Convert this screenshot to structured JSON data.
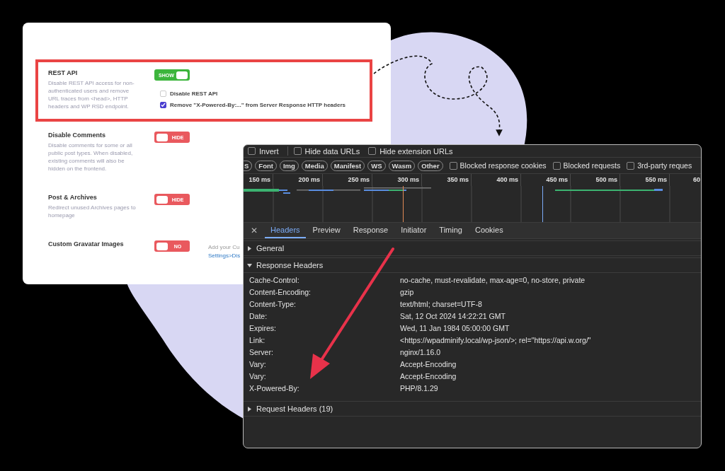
{
  "settings": {
    "rows": [
      {
        "title": "REST API",
        "description": "Disable REST API access for non-authenticated users and remove URL traces from <head>, HTTP headers and WP RSD endpoint.",
        "highlighted": true,
        "toggle": {
          "label": "SHOW",
          "on": true
        },
        "options": [
          {
            "label": "Disable REST API",
            "checked": false
          },
          {
            "label": "Remove \"X-Powered-By:...\" from Server Response HTTP headers",
            "checked": true
          }
        ]
      },
      {
        "title": "Disable Comments",
        "description": "Disable comments for some or all public post types. When disabled, existing comments will also be hidden on the frontend.",
        "highlighted": false,
        "toggle": {
          "label": "HIDE",
          "on": false
        }
      },
      {
        "title": "Post & Archives",
        "description": "Redirect unused Archives pages to homepage",
        "highlighted": false,
        "toggle": {
          "label": "HIDE",
          "on": false
        }
      },
      {
        "title": "Custom Gravatar Images",
        "highlighted": false,
        "toggle": {
          "label": "NO",
          "on": false
        },
        "note": {
          "text": "Add your Cu",
          "link": "Settings>Dis"
        }
      }
    ]
  },
  "devtools": {
    "options": [
      {
        "label": "Invert",
        "checked": false
      },
      {
        "label": "Hide data URLs",
        "checked": false
      },
      {
        "label": "Hide extension URLs",
        "checked": false
      }
    ],
    "filters": [
      {
        "label": "S",
        "selected": false
      },
      {
        "label": "Font",
        "selected": false
      },
      {
        "label": "Img",
        "selected": false
      },
      {
        "label": "Media",
        "selected": false
      },
      {
        "label": "Manifest",
        "selected": false
      },
      {
        "label": "WS",
        "selected": false
      },
      {
        "label": "Wasm",
        "selected": false
      },
      {
        "label": "Other",
        "selected": false
      }
    ],
    "filter_options": [
      {
        "label": "Blocked response cookies",
        "checked": false
      },
      {
        "label": "Blocked requests",
        "checked": false
      },
      {
        "label": "3rd-party reques",
        "checked": false
      }
    ],
    "timeline_ticks": [
      "150 ms",
      "200 ms",
      "250 ms",
      "300 ms",
      "350 ms",
      "400 ms",
      "450 ms",
      "500 ms",
      "550 ms",
      "60"
    ],
    "close": "✕",
    "tabs": [
      {
        "label": "Headers",
        "selected": true
      },
      {
        "label": "Preview",
        "selected": false
      },
      {
        "label": "Response",
        "selected": false
      },
      {
        "label": "Initiator",
        "selected": false
      },
      {
        "label": "Timing",
        "selected": false
      },
      {
        "label": "Cookies",
        "selected": false
      }
    ],
    "sections": [
      {
        "title": "General",
        "expanded": false
      },
      {
        "title": "Response Headers",
        "expanded": true,
        "headers": [
          {
            "name": "Cache-Control:",
            "value": "no-cache, must-revalidate, max-age=0, no-store, private"
          },
          {
            "name": "Content-Encoding:",
            "value": "gzip"
          },
          {
            "name": "Content-Type:",
            "value": "text/html; charset=UTF-8"
          },
          {
            "name": "Date:",
            "value": "Sat, 12 Oct 2024 14:22:21 GMT"
          },
          {
            "name": "Expires:",
            "value": "Wed, 11 Jan 1984 05:00:00 GMT"
          },
          {
            "name": "Link:",
            "value": "<https://wpadminify.local/wp-json/>; rel=\"https://api.w.org/\""
          },
          {
            "name": "Server:",
            "value": "nginx/1.16.0"
          },
          {
            "name": "Vary:",
            "value": "Accept-Encoding"
          },
          {
            "name": "Vary:",
            "value": "Accept-Encoding"
          },
          {
            "name": "X-Powered-By:",
            "value": "PHP/8.1.29"
          }
        ]
      },
      {
        "title": "Request Headers (19)",
        "expanded": false
      }
    ]
  }
}
